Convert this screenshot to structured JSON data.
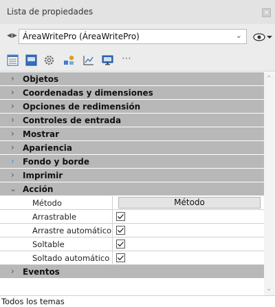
{
  "window": {
    "title": "Lista de propiedades",
    "close_icon": "close-icon"
  },
  "object_selector": {
    "nav_icon": "prev-next-arrows-icon",
    "value": "ÁreaWritePro (ÁreaWritePro)",
    "eye_icon": "visibility-eye-icon"
  },
  "toolbar": {
    "icons": [
      "list-view-icon",
      "theme-icon",
      "settings-gear-icon",
      "objects-icon",
      "chart-icon",
      "display-icon"
    ],
    "more": "⋯"
  },
  "sections": [
    {
      "label": "Objetos",
      "state": "collapsed"
    },
    {
      "label": "Coordenadas y dimensiones",
      "state": "collapsed"
    },
    {
      "label": "Opciones de redimensión",
      "state": "collapsed"
    },
    {
      "label": "Controles de entrada",
      "state": "collapsed"
    },
    {
      "label": "Mostrar",
      "state": "collapsed"
    },
    {
      "label": "Apariencia",
      "state": "collapsed"
    },
    {
      "label": "Fondo y borde",
      "state": "collapsed",
      "accent": "#3b9be0"
    },
    {
      "label": "Imprimir",
      "state": "collapsed"
    },
    {
      "label": "Acción",
      "state": "expanded"
    },
    {
      "label": "Eventos",
      "state": "collapsed"
    }
  ],
  "accion_props": [
    {
      "name": "Método",
      "button_label": "Método"
    },
    {
      "name": "Arrastrable",
      "checked": true
    },
    {
      "name": "Arrastre automático",
      "checked": true
    },
    {
      "name": "Soltable",
      "checked": true
    },
    {
      "name": "Soltado automático",
      "checked": true
    }
  ],
  "status": {
    "label": "Todos los temas"
  },
  "colors": {
    "section_bg": "#b8b8b8",
    "accent": "#3b9be0"
  }
}
